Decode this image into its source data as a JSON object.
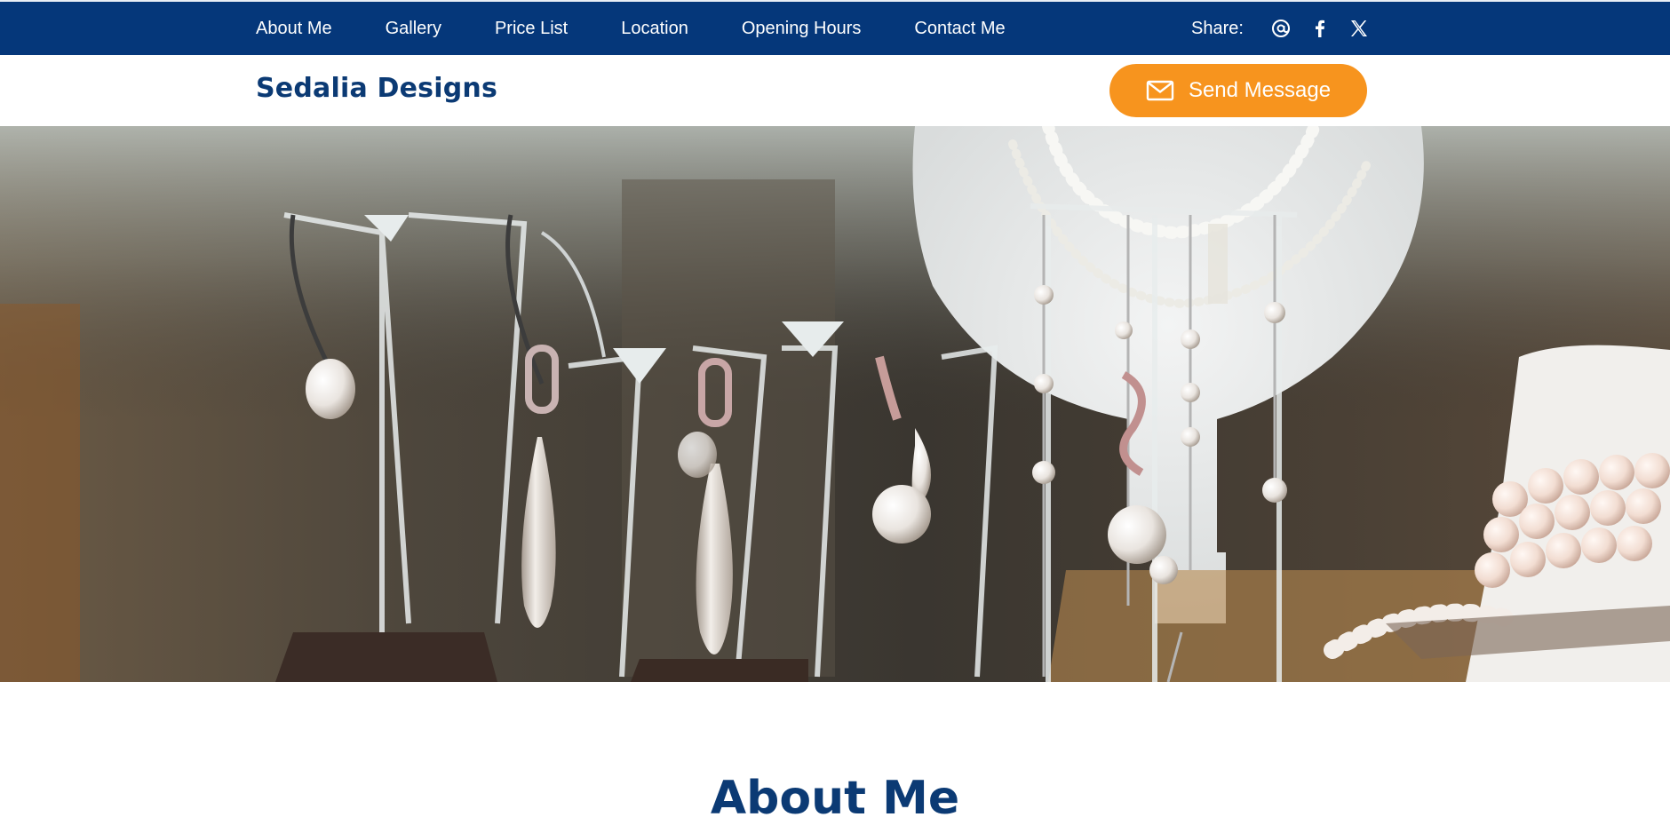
{
  "nav": {
    "items": [
      {
        "label": "About Me"
      },
      {
        "label": "Gallery"
      },
      {
        "label": "Price List"
      },
      {
        "label": "Location"
      },
      {
        "label": "Opening Hours"
      },
      {
        "label": "Contact Me"
      }
    ]
  },
  "share": {
    "label": "Share:",
    "icons": [
      "email-at-icon",
      "facebook-icon",
      "x-twitter-icon"
    ]
  },
  "header": {
    "brand": "Sedalia Designs",
    "send_button_label": "Send Message",
    "send_button_icon": "mail-icon"
  },
  "hero": {
    "image": "jewelry-display-photo"
  },
  "section": {
    "title": "About Me"
  },
  "colors": {
    "nav_bg": "#05377a",
    "brand": "#0b3a74",
    "accent": "#f7941e"
  }
}
